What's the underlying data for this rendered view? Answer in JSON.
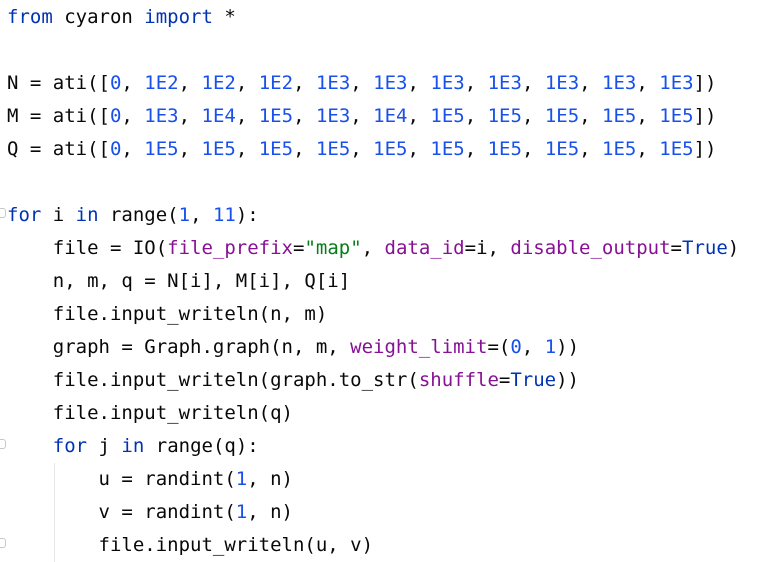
{
  "editor": {
    "lines": [
      {
        "tokens": [
          {
            "t": "from",
            "c": "kw"
          },
          {
            "t": " cyaron "
          },
          {
            "t": "import",
            "c": "kw"
          },
          {
            "t": " *"
          }
        ]
      },
      {
        "tokens": []
      },
      {
        "tokens": [
          {
            "t": "N = ati(["
          },
          {
            "t": "0",
            "c": "num"
          },
          {
            "t": ", "
          },
          {
            "t": "1E2",
            "c": "num"
          },
          {
            "t": ", "
          },
          {
            "t": "1E2",
            "c": "num"
          },
          {
            "t": ", "
          },
          {
            "t": "1E2",
            "c": "num"
          },
          {
            "t": ", "
          },
          {
            "t": "1E3",
            "c": "num"
          },
          {
            "t": ", "
          },
          {
            "t": "1E3",
            "c": "num"
          },
          {
            "t": ", "
          },
          {
            "t": "1E3",
            "c": "num"
          },
          {
            "t": ", "
          },
          {
            "t": "1E3",
            "c": "num"
          },
          {
            "t": ", "
          },
          {
            "t": "1E3",
            "c": "num"
          },
          {
            "t": ", "
          },
          {
            "t": "1E3",
            "c": "num"
          },
          {
            "t": ", "
          },
          {
            "t": "1E3",
            "c": "num"
          },
          {
            "t": "])"
          }
        ]
      },
      {
        "tokens": [
          {
            "t": "M = ati(["
          },
          {
            "t": "0",
            "c": "num"
          },
          {
            "t": ", "
          },
          {
            "t": "1E3",
            "c": "num"
          },
          {
            "t": ", "
          },
          {
            "t": "1E4",
            "c": "num"
          },
          {
            "t": ", "
          },
          {
            "t": "1E5",
            "c": "num"
          },
          {
            "t": ", "
          },
          {
            "t": "1E3",
            "c": "num"
          },
          {
            "t": ", "
          },
          {
            "t": "1E4",
            "c": "num"
          },
          {
            "t": ", "
          },
          {
            "t": "1E5",
            "c": "num"
          },
          {
            "t": ", "
          },
          {
            "t": "1E5",
            "c": "num"
          },
          {
            "t": ", "
          },
          {
            "t": "1E5",
            "c": "num"
          },
          {
            "t": ", "
          },
          {
            "t": "1E5",
            "c": "num"
          },
          {
            "t": ", "
          },
          {
            "t": "1E5",
            "c": "num"
          },
          {
            "t": "])"
          }
        ]
      },
      {
        "tokens": [
          {
            "t": "Q = ati(["
          },
          {
            "t": "0",
            "c": "num"
          },
          {
            "t": ", "
          },
          {
            "t": "1E5",
            "c": "num"
          },
          {
            "t": ", "
          },
          {
            "t": "1E5",
            "c": "num"
          },
          {
            "t": ", "
          },
          {
            "t": "1E5",
            "c": "num"
          },
          {
            "t": ", "
          },
          {
            "t": "1E5",
            "c": "num"
          },
          {
            "t": ", "
          },
          {
            "t": "1E5",
            "c": "num"
          },
          {
            "t": ", "
          },
          {
            "t": "1E5",
            "c": "num"
          },
          {
            "t": ", "
          },
          {
            "t": "1E5",
            "c": "num"
          },
          {
            "t": ", "
          },
          {
            "t": "1E5",
            "c": "num"
          },
          {
            "t": ", "
          },
          {
            "t": "1E5",
            "c": "num"
          },
          {
            "t": ", "
          },
          {
            "t": "1E5",
            "c": "num"
          },
          {
            "t": "])"
          }
        ]
      },
      {
        "tokens": []
      },
      {
        "tokens": [
          {
            "t": "for",
            "c": "kw"
          },
          {
            "t": " i "
          },
          {
            "t": "in",
            "c": "kw"
          },
          {
            "t": " range("
          },
          {
            "t": "1",
            "c": "num"
          },
          {
            "t": ", "
          },
          {
            "t": "11",
            "c": "num"
          },
          {
            "t": "):"
          }
        ]
      },
      {
        "tokens": [
          {
            "t": "    file = IO("
          },
          {
            "t": "file_prefix",
            "c": "param"
          },
          {
            "t": "="
          },
          {
            "t": "\"map\"",
            "c": "str"
          },
          {
            "t": ", "
          },
          {
            "t": "data_id",
            "c": "param"
          },
          {
            "t": "=i, "
          },
          {
            "t": "disable_output",
            "c": "param"
          },
          {
            "t": "="
          },
          {
            "t": "True",
            "c": "kw"
          },
          {
            "t": ")"
          }
        ]
      },
      {
        "tokens": [
          {
            "t": "    n, m, q = N[i], M[i], Q[i]"
          }
        ]
      },
      {
        "tokens": [
          {
            "t": "    file.input_writeln(n, m)"
          }
        ]
      },
      {
        "tokens": [
          {
            "t": "    graph = Graph.graph(n, m, "
          },
          {
            "t": "weight_limit",
            "c": "param"
          },
          {
            "t": "=("
          },
          {
            "t": "0",
            "c": "num"
          },
          {
            "t": ", "
          },
          {
            "t": "1",
            "c": "num"
          },
          {
            "t": "))"
          }
        ]
      },
      {
        "tokens": [
          {
            "t": "    file.input_writeln(graph.to_str("
          },
          {
            "t": "shuffle",
            "c": "param"
          },
          {
            "t": "="
          },
          {
            "t": "True",
            "c": "kw"
          },
          {
            "t": "))"
          }
        ]
      },
      {
        "tokens": [
          {
            "t": "    file.input_writeln(q)"
          }
        ]
      },
      {
        "tokens": [
          {
            "t": "    "
          },
          {
            "t": "for",
            "c": "kw"
          },
          {
            "t": " j "
          },
          {
            "t": "in",
            "c": "kw"
          },
          {
            "t": " range(q):"
          }
        ]
      },
      {
        "tokens": [
          {
            "t": "        u = randint("
          },
          {
            "t": "1",
            "c": "num"
          },
          {
            "t": ", n)"
          }
        ]
      },
      {
        "tokens": [
          {
            "t": "        v = randint("
          },
          {
            "t": "1",
            "c": "num"
          },
          {
            "t": ", n)"
          }
        ]
      },
      {
        "tokens": [
          {
            "t": "        file.input_writeln(u, v)"
          }
        ]
      }
    ]
  },
  "colors": {
    "keyword": "#0033b3",
    "number": "#1750eb",
    "string": "#067d17",
    "parameter": "#871094",
    "text": "#080808",
    "background": "#ffffff"
  }
}
